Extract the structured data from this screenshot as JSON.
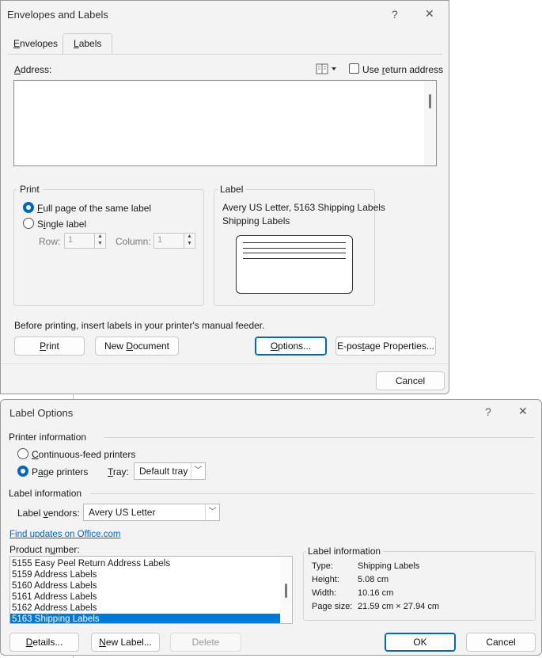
{
  "envelopes_dialog": {
    "title": "Envelopes and Labels",
    "help": "?",
    "close": "✕",
    "tabs": [
      {
        "label": "Envelopes",
        "accel": "E",
        "rest": "nvelopes"
      },
      {
        "label": "Labels",
        "accel": "L",
        "rest": "abels"
      }
    ],
    "address_label": {
      "accel": "A",
      "rest": "ddress:"
    },
    "use_return_address": {
      "pre": "Use ",
      "accel": "r",
      "rest": "eturn address"
    },
    "address_value": "",
    "print_group": {
      "title": "Print",
      "full_page": {
        "accel": "F",
        "rest": "ull page of the same label"
      },
      "single_label": {
        "pre": "S",
        "accel": "i",
        "rest": "ngle label"
      },
      "row_label": "Row:",
      "row_value": "1",
      "column_label": "Column:",
      "column_value": "1"
    },
    "label_group": {
      "title": "Label",
      "line1": "Avery US Letter, 5163 Shipping Labels",
      "line2": "Shipping Labels"
    },
    "hint": "Before printing, insert labels in your printer's manual feeder.",
    "buttons": {
      "print": {
        "accel": "P",
        "rest": "rint"
      },
      "new_document": {
        "pre": "New ",
        "accel": "D",
        "rest": "ocument"
      },
      "options": {
        "accel": "O",
        "rest": "ptions..."
      },
      "epostage": {
        "pre": "E-pos",
        "accel": "t",
        "rest": "age Properties..."
      },
      "cancel": "Cancel"
    }
  },
  "label_options": {
    "title": "Label Options",
    "help": "?",
    "close": "✕",
    "printer_info_title": "Printer information",
    "continuous_feed": {
      "accel": "C",
      "rest": "ontinuous-feed printers"
    },
    "page_printers": {
      "pre": "P",
      "accel": "a",
      "rest": "ge printers"
    },
    "tray_label": {
      "accel": "T",
      "rest": "ray:"
    },
    "tray_value": "Default tray",
    "label_info_title": "Label information",
    "vendors_label": {
      "pre": "Label ",
      "accel": "v",
      "rest": "endors:"
    },
    "vendor_value": "Avery US Letter",
    "find_updates": "Find updates on Office.com",
    "product_number_label": {
      "pre": "Product n",
      "accel": "u",
      "rest": "mber:"
    },
    "products": [
      "5155 Easy Peel Return Address Labels",
      "5159 Address Labels",
      "5160 Address Labels",
      "5161 Address Labels",
      "5162 Address Labels",
      "5163 Shipping Labels"
    ],
    "selected_product_index": 5,
    "info_box": {
      "title": "Label information",
      "type_label": "Type:",
      "type_value": "Shipping Labels",
      "height_label": "Height:",
      "height_value": "5.08 cm",
      "width_label": "Width:",
      "width_value": "10.16 cm",
      "page_size_label": "Page size:",
      "page_size_value": "21.59 cm × 27.94 cm"
    },
    "buttons": {
      "details": {
        "accel": "D",
        "rest": "etails..."
      },
      "new_label": {
        "accel": "N",
        "rest": "ew Label..."
      },
      "delete": "Delete",
      "ok": "OK",
      "cancel": "Cancel"
    }
  }
}
